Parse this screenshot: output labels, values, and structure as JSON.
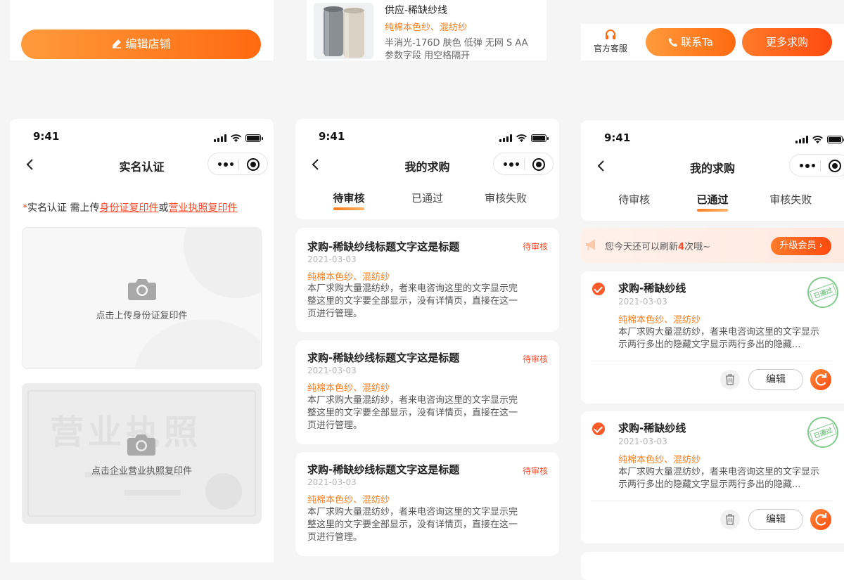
{
  "top_left": {
    "edit_store_label": "编辑店铺"
  },
  "top_middle": {
    "title": "供应-稀缺纱线",
    "tags": "纯棉本色纱、混纺纱",
    "spec_line1": "半消光-176D 肤色 低弹 无网 S AA",
    "spec_line2": "参数字段 用空格隔开"
  },
  "top_right": {
    "service_label": "官方客服",
    "contact_label": "联系Ta",
    "more_label": "更多求购"
  },
  "time": "9:41",
  "verify": {
    "title": "实名认证",
    "hint_star": "*",
    "hint_prefix": "实名认证 需上传",
    "hint_id": "身份证复印件",
    "hint_or": "或",
    "hint_license": "营业执照复印件",
    "upload_id_label": "点击上传身份证复印件",
    "license_watermark": "营业执照",
    "upload_license_label": "点击企业营业执照复印件"
  },
  "pending": {
    "title": "我的求购",
    "tabs": [
      "待审核",
      "已通过",
      "审核失败"
    ],
    "items": [
      {
        "title": "求购-稀缺纱线标题文字这是标题",
        "status": "待审核",
        "date": "2021-03-03",
        "tags": "纯棉本色纱、混纺纱",
        "desc": [
          "本厂求购大量混纺纱，者来电咨询这里的文字显示完",
          "整这里的文字要全部显示，没有详情页，直接在这一",
          "页进行管理。"
        ]
      },
      {
        "title": "求购-稀缺纱线标题文字这是标题",
        "status": "待审核",
        "date": "2021-03-03",
        "tags": "纯棉本色纱、混纺纱",
        "desc": [
          "本厂求购大量混纺纱，者来电咨询这里的文字显示完",
          "整这里的文字要全部显示，没有详情页，直接在这一",
          "页进行管理。"
        ]
      },
      {
        "title": "求购-稀缺纱线标题文字这是标题",
        "status": "待审核",
        "date": "2021-03-03",
        "tags": "纯棉本色纱、混纺纱",
        "desc": [
          "本厂求购大量混纺纱，者来电咨询这里的文字显示完",
          "整这里的文字要全部显示，没有详情页，直接在这一",
          "页进行管理。"
        ]
      }
    ]
  },
  "approved": {
    "title": "我的求购",
    "tabs": [
      "待审核",
      "已通过",
      "审核失败"
    ],
    "banner_prefix": "您今天还可以刷新",
    "banner_count": "4",
    "banner_suffix": "次哦~",
    "upgrade_label": "升级会员",
    "stamp_text": "已通过",
    "edit_label": "编辑",
    "items": [
      {
        "title": "求购-稀缺纱线",
        "date": "2021-03-03",
        "tags": "纯棉本色纱、混纺纱",
        "desc": [
          "本厂求购大量混纺纱，者来电咨询这里的文字显示",
          "示两行多出的隐藏文字显示两行多出的隐藏..."
        ]
      },
      {
        "title": "求购-稀缺纱线",
        "date": "2021-03-03",
        "tags": "纯棉本色纱、混纺纱",
        "desc": [
          "本厂求购大量混纺纱，者来电咨询这里的文字显示",
          "示两行多出的隐藏文字显示两行多出的隐藏..."
        ]
      }
    ]
  },
  "colors": {
    "accent": "#ff7d1a",
    "red": "#ff4b2b",
    "green_stamp": "#6cc27a"
  }
}
